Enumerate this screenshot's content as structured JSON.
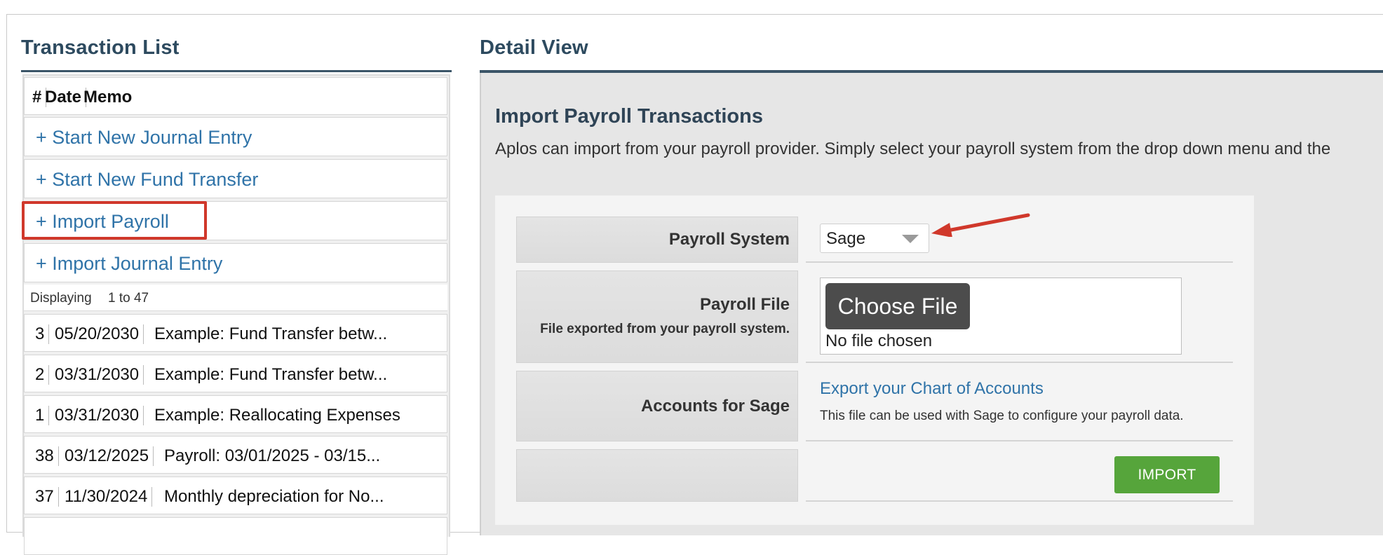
{
  "transaction_list": {
    "title": "Transaction List",
    "columns": [
      "#",
      "Date",
      "Memo"
    ],
    "actions": [
      "+ Start New Journal Entry",
      "+ Start New Fund Transfer",
      "+ Import Payroll",
      "+ Import Journal Entry"
    ],
    "displaying": {
      "label": "Displaying",
      "range": "1 to 47"
    },
    "rows": [
      {
        "num": "3",
        "date": "05/20/2030",
        "memo": "Example: Fund Transfer betw..."
      },
      {
        "num": "2",
        "date": "03/31/2030",
        "memo": "Example: Fund Transfer betw..."
      },
      {
        "num": "1",
        "date": "03/31/2030",
        "memo": "Example: Reallocating Expenses"
      },
      {
        "num": "38",
        "date": "03/12/2025",
        "memo": "Payroll: 03/01/2025 - 03/15..."
      },
      {
        "num": "37",
        "date": "11/30/2024",
        "memo": "Monthly depreciation for No..."
      }
    ]
  },
  "detail_view": {
    "title": "Detail View",
    "heading": "Import Payroll Transactions",
    "description": "Aplos can import from your payroll provider. Simply select your payroll system from the drop down menu and the",
    "payroll_system": {
      "label": "Payroll System",
      "selected": "Sage"
    },
    "payroll_file": {
      "label": "Payroll File",
      "sublabel": "File exported from your payroll system.",
      "button": "Choose File",
      "status": "No file chosen"
    },
    "accounts": {
      "label": "Accounts for Sage",
      "link": "Export your Chart of Accounts",
      "note": "This file can be used with Sage to configure your payroll data."
    },
    "import_button": "IMPORT"
  },
  "colors": {
    "accent_link": "#2f73a8",
    "title": "#2d4a5f",
    "highlight": "#d0382b",
    "import_button": "#56a53b",
    "choose_button": "#4c4c4c"
  }
}
